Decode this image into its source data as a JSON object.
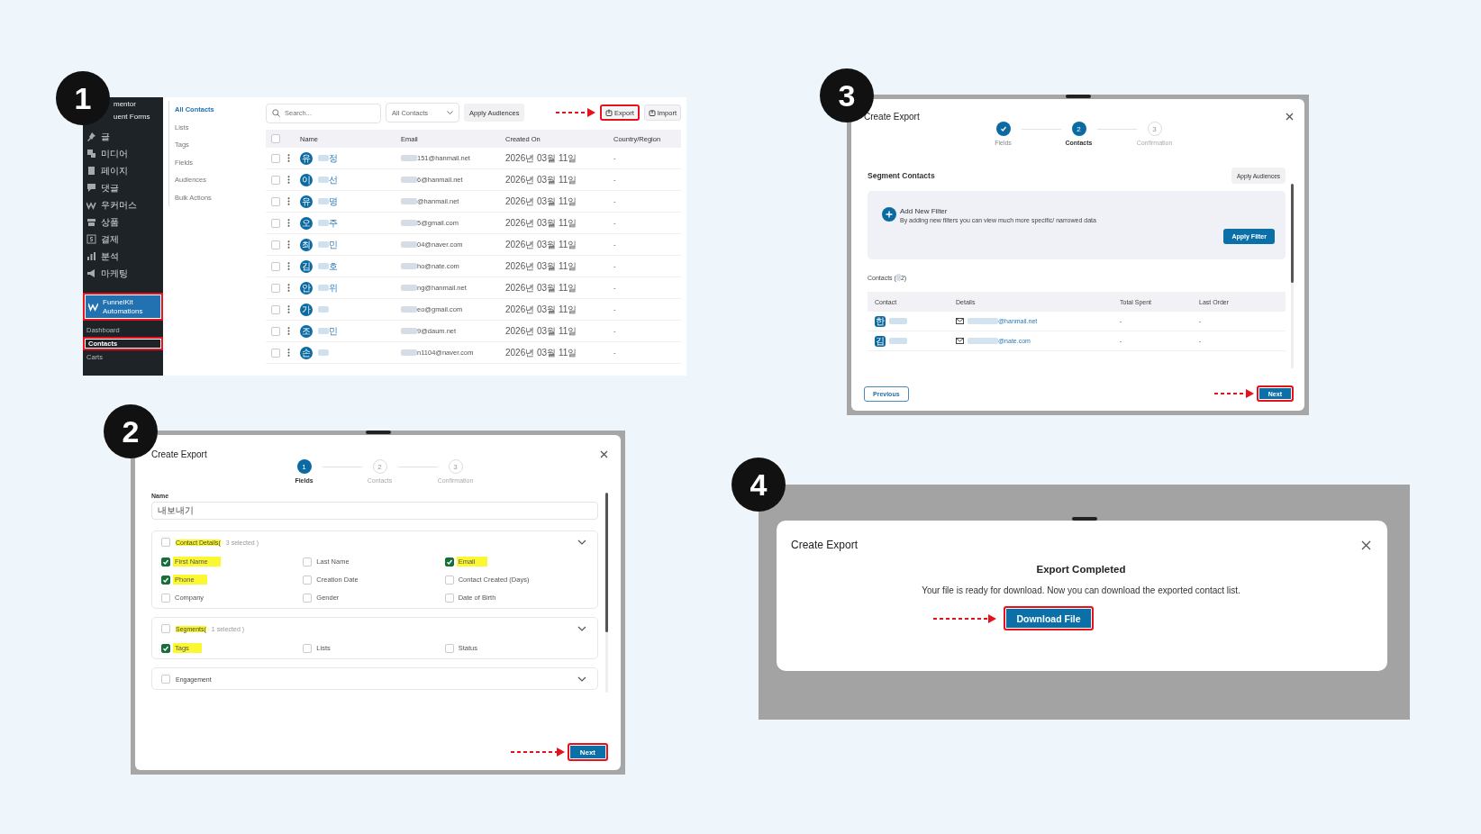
{
  "steps": [
    {
      "kind": "contacts_page",
      "badge": "1",
      "sidebar": {
        "items": [
          {
            "kind": "plugin",
            "label": "mentor",
            "selected": false,
            "annotated": false
          },
          {
            "kind": "plugin",
            "label": "uent Forms",
            "selected": false,
            "annotated": false
          },
          {
            "kind": "menu",
            "label": "글",
            "selected": false,
            "annotated": false
          },
          {
            "kind": "menu",
            "label": "미디어",
            "selected": false,
            "annotated": false
          },
          {
            "kind": "menu",
            "label": "페이지",
            "selected": false,
            "annotated": false
          },
          {
            "kind": "menu",
            "label": "댓글",
            "selected": false,
            "annotated": false
          },
          {
            "kind": "menu",
            "label": "우커머스",
            "selected": false,
            "annotated": false
          },
          {
            "kind": "menu",
            "label": "상품",
            "selected": false,
            "annotated": false
          },
          {
            "kind": "menu",
            "label": "결제",
            "selected": false,
            "annotated": false
          },
          {
            "kind": "menu",
            "label": "분석",
            "selected": false,
            "annotated": false
          },
          {
            "kind": "menu",
            "label": "마케팅",
            "selected": false,
            "annotated": false
          },
          {
            "kind": "section",
            "label": "FunnelKit Automations",
            "selected": true,
            "annotated": true
          },
          {
            "kind": "submenu",
            "label": "Dashboard",
            "selected": false,
            "annotated": false
          },
          {
            "kind": "submenu",
            "label": "Contacts",
            "selected": true,
            "annotated": true
          },
          {
            "kind": "submenu",
            "label": "Carts",
            "selected": false,
            "annotated": false
          }
        ]
      },
      "subnav": [
        {
          "label": "All Contacts",
          "selected": true
        },
        {
          "label": "Lists",
          "selected": false
        },
        {
          "label": "Tags",
          "selected": false
        },
        {
          "label": "Fields",
          "selected": false
        },
        {
          "label": "Audiences",
          "selected": false
        },
        {
          "label": "Bulk Actions",
          "selected": false
        }
      ],
      "toolbar": {
        "search": {
          "placeholder": "Search..."
        },
        "audience_select": {
          "value": "All Contacts"
        },
        "apply_button": {
          "label": "Apply Audiences"
        },
        "export_button": {
          "label": "Export",
          "annotated": true
        },
        "import_button": {
          "label": "Import"
        }
      },
      "table": {
        "header_checked": false,
        "columns": [
          "Name",
          "Email",
          "Created On",
          "Country/Region"
        ],
        "rows": [
          {
            "checked": false,
            "avatar": "유",
            "name": "정",
            "email": "151@hanmail.net",
            "created": "2026년 03월 11일",
            "country": "-"
          },
          {
            "checked": false,
            "avatar": "이",
            "name": "선",
            "email": "6@hanmail.net",
            "created": "2026년 03월 11일",
            "country": "-"
          },
          {
            "checked": false,
            "avatar": "유",
            "name": "명",
            "email": "@hanmail.net",
            "created": "2026년 03월 11일",
            "country": "-"
          },
          {
            "checked": false,
            "avatar": "오",
            "name": "주",
            "email": "5@gmail.com",
            "created": "2026년 03월 11일",
            "country": "-"
          },
          {
            "checked": false,
            "avatar": "최",
            "name": "민",
            "email": "04@naver.com",
            "created": "2026년 03월 11일",
            "country": "-"
          },
          {
            "checked": false,
            "avatar": "김",
            "name": "호",
            "email": "ho@nate.com",
            "created": "2026년 03월 11일",
            "country": "-"
          },
          {
            "checked": false,
            "avatar": "안",
            "name": "위",
            "email": "ng@hanmail.net",
            "created": "2026년 03월 11일",
            "country": "-"
          },
          {
            "checked": false,
            "avatar": "가",
            "email": "eo@gmail.com",
            "created": "2026년 03월 11일",
            "country": "-"
          },
          {
            "checked": false,
            "avatar": "조",
            "name": "민",
            "email": "9@daum.net",
            "created": "2026년 03월 11일",
            "country": "-"
          },
          {
            "checked": false,
            "avatar": "손",
            "email": "n1104@naver.com",
            "created": "2026년 03월 11일",
            "country": "-"
          }
        ]
      }
    },
    {
      "kind": "export_fields",
      "badge": "2",
      "dialog": {
        "title": "Create Export",
        "steps": [
          {
            "number": "1",
            "label": "Fields",
            "selected": true,
            "completed": false
          },
          {
            "number": "2",
            "label": "Contacts",
            "selected": false,
            "completed": false
          },
          {
            "number": "3",
            "label": "Confirmation",
            "selected": false,
            "completed": false
          }
        ],
        "name_field": {
          "label": "Name",
          "value": "내보내기"
        },
        "sections": [
          {
            "title": "Contact Details(",
            "note": "3 selected )",
            "checked": false,
            "highlighted": true,
            "fields": [
              {
                "label": "First Name",
                "checked": true,
                "highlighted": true
              },
              {
                "label": "Last Name",
                "checked": false,
                "highlighted": false
              },
              {
                "label": "Email",
                "checked": true,
                "highlighted": true
              },
              {
                "label": "Phone",
                "checked": true,
                "highlighted": true
              },
              {
                "label": "Creation Date",
                "checked": false,
                "highlighted": false
              },
              {
                "label": "Contact Created (Days)",
                "checked": false,
                "highlighted": false
              },
              {
                "label": "Company",
                "checked": false,
                "highlighted": false
              },
              {
                "label": "Gender",
                "checked": false,
                "highlighted": false
              },
              {
                "label": "Date of Birth",
                "checked": false,
                "highlighted": false
              }
            ]
          },
          {
            "title": "Segments(",
            "note": "1 selected )",
            "checked": false,
            "highlighted": true,
            "fields": [
              {
                "label": "Tags",
                "checked": true,
                "highlighted": true
              },
              {
                "label": "Lists",
                "checked": false,
                "highlighted": false
              },
              {
                "label": "Status",
                "checked": false,
                "highlighted": false
              }
            ]
          },
          {
            "title": "Engagement",
            "checked": false,
            "highlighted": false
          }
        ],
        "next_button": {
          "label": "Next",
          "annotated": true
        }
      }
    },
    {
      "kind": "export_contacts",
      "badge": "3",
      "dialog": {
        "title": "Create Export",
        "steps": [
          {
            "label": "Fields",
            "selected": false,
            "completed": true
          },
          {
            "number": "2",
            "label": "Contacts",
            "selected": true,
            "completed": false
          },
          {
            "number": "3",
            "label": "Confirmation",
            "selected": false,
            "completed": false
          }
        ],
        "segment": {
          "heading": "Segment Contacts",
          "apply_button": {
            "label": "Apply Audiences"
          }
        },
        "filter": {
          "title": "Add New Filter",
          "description": "By adding new filters you can view much more specific/ narrowed data",
          "apply_button": {
            "label": "Apply Filter"
          }
        },
        "contacts": {
          "heading": "Contacts (",
          "count": "2)",
          "columns": [
            "Contact",
            "Details",
            "Total Spent",
            "Last Order"
          ],
          "rows": [
            {
              "avatar": "한",
              "email": "@hanmail.net",
              "total_spent": "-",
              "last_order": "-"
            },
            {
              "avatar": "김",
              "email": "@nate.com",
              "total_spent": "-",
              "last_order": "-"
            }
          ]
        },
        "previous_button": {
          "label": "Previous"
        },
        "next_button": {
          "label": "Next",
          "annotated": true
        }
      }
    },
    {
      "kind": "export_done",
      "badge": "4",
      "dialog": {
        "title": "Create Export",
        "heading": "Export Completed",
        "message": "Your file is ready for download. Now you can download the exported contact list.",
        "download_button": {
          "label": "Download File",
          "annotated": true
        }
      }
    }
  ]
}
